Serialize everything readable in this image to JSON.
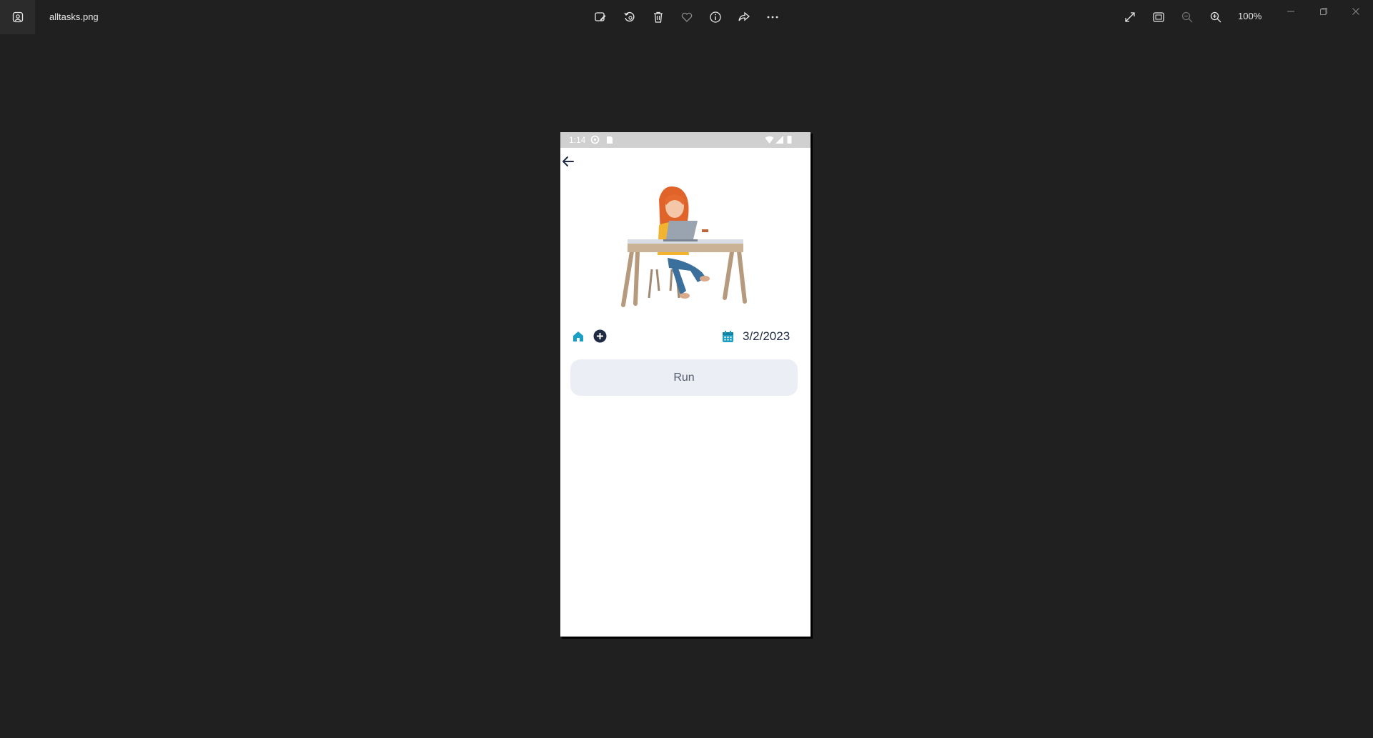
{
  "viewer": {
    "file_name": "alltasks.png",
    "zoom_level": "100%",
    "toolbar": [
      {
        "name": "edit-image-icon"
      },
      {
        "name": "rotate-icon"
      },
      {
        "name": "delete-icon"
      },
      {
        "name": "favorite-icon"
      },
      {
        "name": "info-icon"
      },
      {
        "name": "share-icon"
      },
      {
        "name": "more-icon"
      }
    ],
    "right_tools": [
      {
        "name": "fullscreen-icon"
      },
      {
        "name": "fit-window-icon"
      },
      {
        "name": "zoom-out-icon"
      },
      {
        "name": "zoom-in-icon"
      }
    ]
  },
  "phone": {
    "status_time": "1:14",
    "date": "3/2/2023",
    "run_label": "Run",
    "accent_color": "#1aa0c4",
    "navy_color": "#1f2a44"
  }
}
